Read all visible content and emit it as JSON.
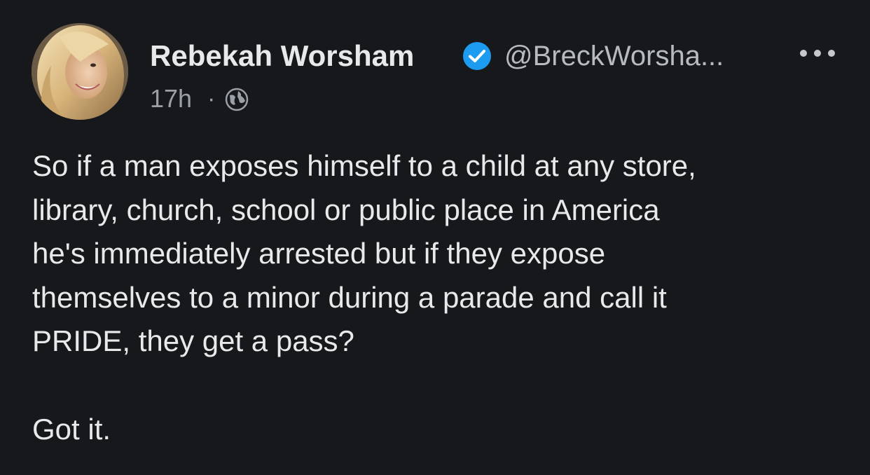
{
  "post": {
    "author_name": "Rebekah Worsham",
    "author_handle": "@BreckWorsha...",
    "verified": true,
    "timestamp": "17h",
    "separator": "·",
    "visibility_icon": "globe-icon",
    "more_icon": "more-options-icon",
    "body": "So if a man exposes himself to a child at any store,\nlibrary, church, school or public place in America\nhe's immediately arrested but if they expose\nthemselves to a minor during a parade and call it\nPRIDE, they get a pass?",
    "followup": "Got it."
  },
  "colors": {
    "background": "#16181c",
    "text": "#e7e9ea",
    "secondary_text": "#9aa0a6",
    "verified_blue": "#1d9bf0"
  }
}
